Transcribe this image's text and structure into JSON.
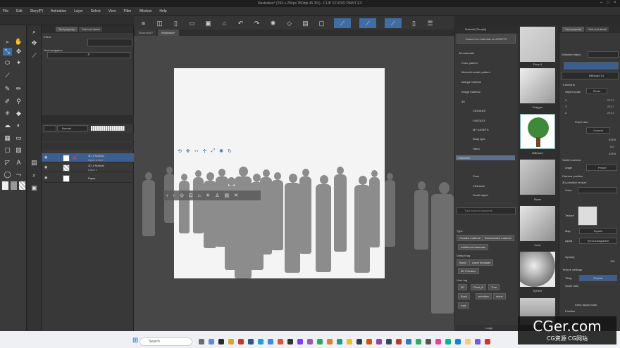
{
  "window": {
    "title": "Illustration* (294 x 294px 350dpi 46.3%) - CLIP STUDIO PAINT EX"
  },
  "menu": [
    "File",
    "Edit",
    "Story(P)",
    "Animation",
    "Layer",
    "Select",
    "View",
    "Filter",
    "Window",
    "Help"
  ],
  "tool_property": {
    "tabs": [
      "Tool property",
      "Sub tool detail"
    ],
    "title": "Effect",
    "section": "Tool navigation"
  },
  "layers": {
    "blend_mode": "Normal",
    "rows": [
      {
        "name": "3D 1 Normal",
        "sub": "Open a clue"
      },
      {
        "name": "3D 1 Normal",
        "sub": "Layer 1"
      },
      {
        "name": "Paper",
        "sub": ""
      }
    ]
  },
  "document_tabs": [
    "Illustration*",
    "Illustration*"
  ],
  "material_panel": {
    "title": "Material [People]",
    "search_placeholder": "Search for materials on ASSETS",
    "tree": [
      "All materials",
      "Color pattern",
      "Monochromatic pattern",
      "Manga material",
      "Image material",
      "3D",
      "CROWDS",
      "FANTASY",
      "MY ASSETS",
      "Body type",
      "Hand",
      "Character",
      "Pose",
      "Character",
      "Small object"
    ],
    "selected_tree_item": "Character",
    "filter_placeholder": "Type search keywords",
    "type_label": "Type",
    "type_tags": [
      "Created material",
      "Downloaded material",
      "Additional materials"
    ],
    "default_tag_label": "Default tag",
    "default_tags": [
      "Basic",
      "Layer template",
      "3D Primitive"
    ],
    "user_tag_label": "User tag",
    "user_tags": [
      "3D",
      "Plant_B",
      "Tree",
      "Bush",
      "primitive",
      "stone",
      "rock"
    ],
    "view_label": "Large"
  },
  "thumbnails": [
    {
      "caption": "Floor 4"
    },
    {
      "caption": "Polygon"
    },
    {
      "caption": "Billboard"
    },
    {
      "caption": "Plane"
    },
    {
      "caption": "Cube"
    },
    {
      "caption": "Sphere"
    },
    {
      "caption": "Cylinder"
    }
  ],
  "object_panel": {
    "tabs": [
      "Tool property",
      "Sub tool detail"
    ],
    "title": "Tool property [Object]",
    "selected_object_label": "Selected object",
    "billboard_name": "Billboard 14",
    "transform_label": "Transform",
    "object_scale_label": "Object scale",
    "reset_label": "Reset",
    "x_val": "272.7",
    "y_val": "272.7",
    "z_val": "272.7",
    "fixed_ratio": "Fixed ratio",
    "ground_label": "Ground",
    "pos_x": "628.8",
    "pos_y": "0.0",
    "pos_z": "428.6",
    "switch_camera": "Switch camera",
    "angle_label": "Angle",
    "preset_label": "Preset",
    "camera_position": "Camera position",
    "primitive_texture": "3D primitive texture",
    "color_label": "Color",
    "texture_label": "Texture",
    "map_label": "Map",
    "map_value": "Square",
    "alpha_label": "Alpha",
    "alpha_value": "Semi-transparent",
    "opacity_label": "Opacity",
    "opacity_value": "100",
    "texture_settings": "Texture settings",
    "tiling_label": "Tiling",
    "tiling_value": "Repeat",
    "scale_ratio_label": "Scale ratio",
    "keep_aspect": "Keep aspect ratio",
    "position_label": "Position"
  },
  "taskbar": {
    "search_placeholder": "Search"
  },
  "watermark": {
    "line1": "CGer.com",
    "line2": "CG资源 CG网站"
  }
}
